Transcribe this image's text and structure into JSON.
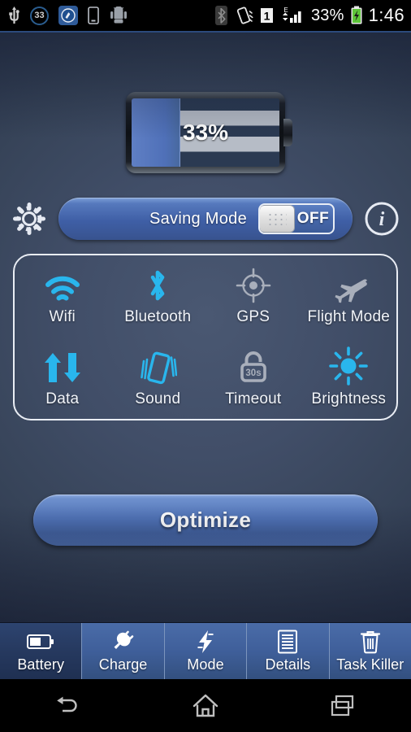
{
  "status_bar": {
    "left_icons": [
      {
        "name": "usb-icon",
        "label": "USB"
      },
      {
        "name": "battery-percent-badge-icon",
        "label": "33"
      },
      {
        "name": "cleaner-app-icon",
        "label": "Cleaner"
      },
      {
        "name": "sim-card-icon",
        "label": "SIM"
      },
      {
        "name": "android-robot-icon",
        "label": "Android"
      }
    ],
    "right_icons": [
      {
        "name": "bluetooth-icon",
        "label": "Bluetooth"
      },
      {
        "name": "vibrate-icon",
        "label": "Vibrate"
      },
      {
        "name": "sim1-signal-icon",
        "label": "1"
      },
      {
        "name": "edge-network-icon",
        "label": "E"
      },
      {
        "name": "signal-bars-icon",
        "label": "Signal"
      }
    ],
    "battery_percent": "33%",
    "battery_charging_icon": "battery-charging-icon",
    "clock": "1:46"
  },
  "battery": {
    "percent_label": "33%",
    "fill_percent": 33
  },
  "saving_mode": {
    "settings_icon": "gear-icon",
    "label": "Saving Mode",
    "switch_state": "OFF",
    "info_icon": "info-icon"
  },
  "toggles": [
    {
      "id": "wifi",
      "label": "Wifi",
      "icon": "wifi-icon",
      "active": true
    },
    {
      "id": "bluetooth",
      "label": "Bluetooth",
      "icon": "bluetooth-icon",
      "active": true
    },
    {
      "id": "gps",
      "label": "GPS",
      "icon": "gps-icon",
      "active": false
    },
    {
      "id": "flight",
      "label": "Flight Mode",
      "icon": "airplane-icon",
      "active": false
    },
    {
      "id": "data",
      "label": "Data",
      "icon": "data-arrows-icon",
      "active": true
    },
    {
      "id": "sound",
      "label": "Sound",
      "icon": "vibrate-icon",
      "active": true
    },
    {
      "id": "timeout",
      "label": "Timeout",
      "icon": "lock-icon",
      "active": false,
      "badge": "30s"
    },
    {
      "id": "brightness",
      "label": "Brightness",
      "icon": "sun-icon",
      "active": true
    }
  ],
  "optimize_button": {
    "label": "Optimize"
  },
  "tabs": [
    {
      "id": "battery",
      "label": "Battery",
      "icon": "battery-icon",
      "active": true
    },
    {
      "id": "charge",
      "label": "Charge",
      "icon": "plug-icon",
      "active": false
    },
    {
      "id": "mode",
      "label": "Mode",
      "icon": "lightning-icon",
      "active": false
    },
    {
      "id": "details",
      "label": "Details",
      "icon": "document-icon",
      "active": false
    },
    {
      "id": "task_killer",
      "label": "Task Killer",
      "icon": "trash-icon",
      "active": false
    }
  ],
  "nav_bar": [
    {
      "id": "back",
      "icon": "back-arrow-icon"
    },
    {
      "id": "home",
      "icon": "home-icon"
    },
    {
      "id": "recent",
      "icon": "recent-apps-icon"
    }
  ],
  "colors": {
    "accent_cyan": "#29b6ed",
    "inactive_gray": "#a9afbb",
    "tab_blue": "#3f5f9a",
    "tab_active_blue": "#26395f",
    "battery_fill": "#4f70b8"
  }
}
